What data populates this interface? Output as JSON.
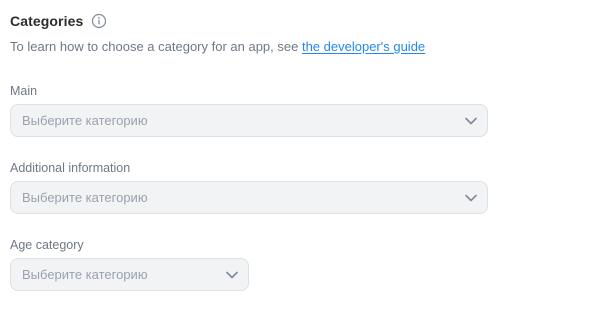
{
  "section": {
    "title": "Categories",
    "description": "To learn how to choose a category for an app, see ",
    "link_text": "the developer's guide"
  },
  "fields": {
    "main": {
      "label": "Main",
      "placeholder": "Выберите категорию"
    },
    "additional": {
      "label": "Additional information",
      "placeholder": "Выберите категорию"
    },
    "age": {
      "label": "Age category",
      "placeholder": "Выберите категорию"
    }
  },
  "icons": {
    "info": "info-icon",
    "chevron": "chevron-down-icon"
  },
  "colors": {
    "link": "#2688eb",
    "secondary_text": "#6f7985",
    "placeholder": "#99a2ad",
    "field_bg": "#f2f3f5"
  }
}
